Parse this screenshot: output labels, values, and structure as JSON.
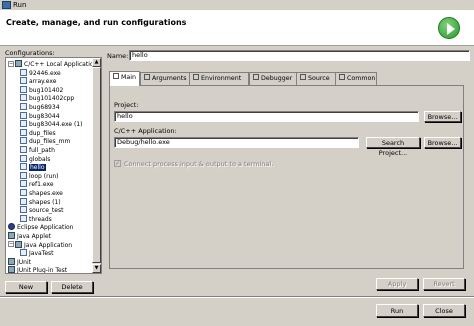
{
  "window": {
    "title": "Run"
  },
  "header": {
    "title": "Create, manage, and run configurations"
  },
  "left": {
    "label": "Configurations:",
    "tree": [
      {
        "label": "C/C++ Local Application",
        "expander": "−",
        "kind": "cat"
      },
      {
        "label": "92446.exe",
        "kind": "item"
      },
      {
        "label": "array.exe",
        "kind": "item"
      },
      {
        "label": "bug101402",
        "kind": "item"
      },
      {
        "label": "bug101402cpp",
        "kind": "item"
      },
      {
        "label": "bug68934",
        "kind": "item"
      },
      {
        "label": "bug83044",
        "kind": "item"
      },
      {
        "label": "bug83044.exe (1)",
        "kind": "item"
      },
      {
        "label": "dup_files",
        "kind": "item"
      },
      {
        "label": "dup_files_mm",
        "kind": "item"
      },
      {
        "label": "full_path",
        "kind": "item"
      },
      {
        "label": "globals",
        "kind": "item"
      },
      {
        "label": "hello",
        "kind": "item",
        "selected": true
      },
      {
        "label": "loop (run)",
        "kind": "item"
      },
      {
        "label": "ref1.exe",
        "kind": "item"
      },
      {
        "label": "shapes.exe",
        "kind": "item"
      },
      {
        "label": "shapes (1)",
        "kind": "item"
      },
      {
        "label": "source_test",
        "kind": "item"
      },
      {
        "label": "threads",
        "kind": "item"
      },
      {
        "label": "Eclipse Application",
        "kind": "ecl"
      },
      {
        "label": "Java Applet",
        "kind": "cat"
      },
      {
        "label": "Java Application",
        "expander": "−",
        "kind": "cat"
      },
      {
        "label": "JavaTest",
        "kind": "item"
      },
      {
        "label": "JUnit",
        "kind": "cat"
      },
      {
        "label": "JUnit Plug-in Test",
        "kind": "cat"
      }
    ],
    "new_label": "New",
    "delete_label": "Delete"
  },
  "name": {
    "label": "Name:",
    "value": "hello"
  },
  "tabs": [
    "Main",
    "Arguments",
    "Environment",
    "Debugger",
    "Source",
    "Common"
  ],
  "main": {
    "project_label": "Project:",
    "project_value": "hello",
    "browse1_label": "Browse...",
    "app_label": "C/C++ Application:",
    "app_value": "Debug/hello.exe",
    "search_label": "Search Project...",
    "browse2_label": "Browse...",
    "connect_label": "Connect process input & output to a terminal."
  },
  "actions": {
    "apply_label": "Apply",
    "revert_label": "Revert",
    "run_label": "Run",
    "close_label": "Close"
  }
}
